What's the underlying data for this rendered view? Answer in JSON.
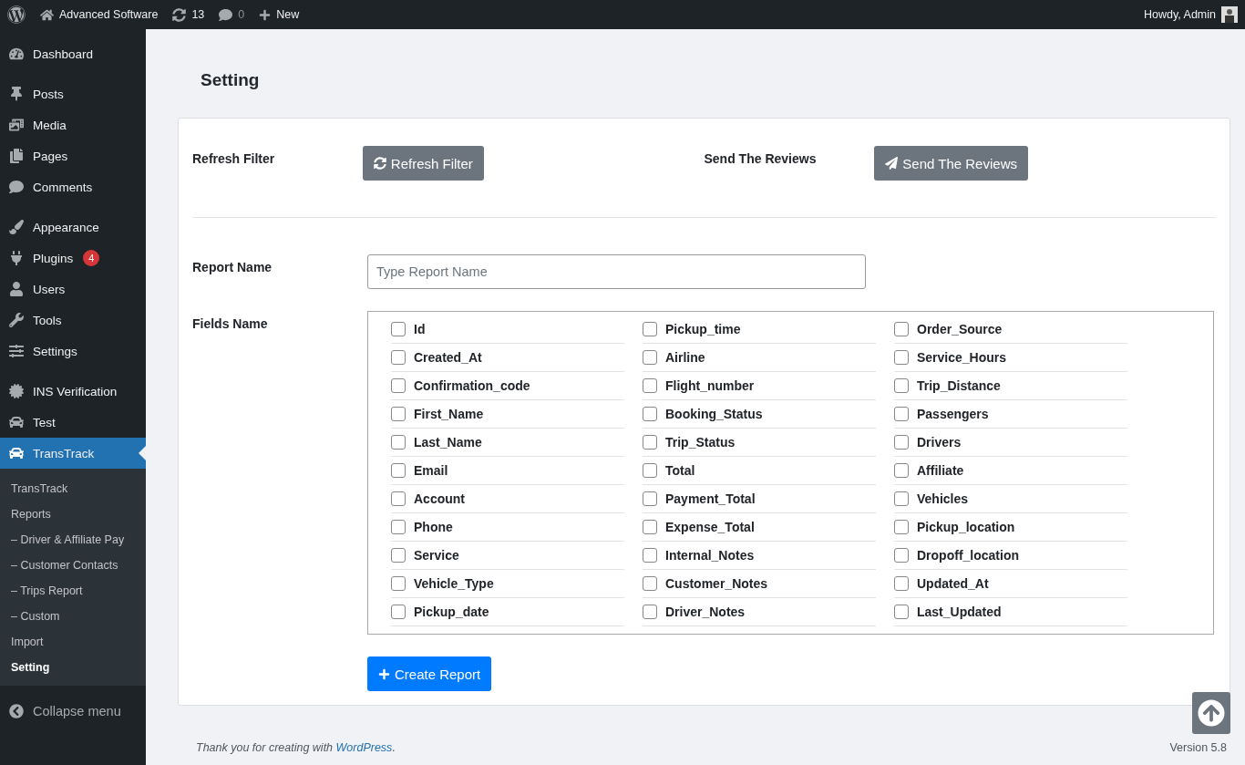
{
  "admin_bar": {
    "site_name": "Advanced Software",
    "updates": "13",
    "comments": "0",
    "new_label": "New",
    "greeting": "Howdy, Admin"
  },
  "sidebar": {
    "groups": [
      [
        {
          "label": "Dashboard",
          "selected": false
        }
      ],
      [
        {
          "label": "Posts",
          "selected": false
        },
        {
          "label": "Media",
          "selected": false
        },
        {
          "label": "Pages",
          "selected": false
        },
        {
          "label": "Comments",
          "selected": false
        }
      ],
      [
        {
          "label": "Appearance",
          "selected": false
        },
        {
          "label": "Plugins",
          "selected": false,
          "badge": "4"
        },
        {
          "label": "Users",
          "selected": false
        },
        {
          "label": "Tools",
          "selected": false
        },
        {
          "label": "Settings",
          "selected": false
        }
      ],
      [
        {
          "label": "INS Verification",
          "selected": false
        },
        {
          "label": "Test",
          "selected": false
        },
        {
          "label": "TransTrack",
          "selected": true,
          "children": [
            {
              "label": "TransTrack",
              "selected": false
            },
            {
              "label": "Reports",
              "selected": false
            },
            {
              "label": "– Driver & Affiliate Pay",
              "selected": false
            },
            {
              "label": "– Customer Contacts",
              "selected": false
            },
            {
              "label": "– Trips Report",
              "selected": false
            },
            {
              "label": "– Custom",
              "selected": false
            },
            {
              "label": "Import",
              "selected": false
            },
            {
              "label": "Setting",
              "selected": true
            }
          ]
        }
      ]
    ],
    "collapse_label": "Collapse menu"
  },
  "page_title": "Setting",
  "actions": [
    {
      "label": "Refresh Filter",
      "button": "Refresh Filter",
      "kind": "refresh"
    },
    {
      "label": "Send The Reviews",
      "button": "Send The Reviews",
      "kind": "send"
    }
  ],
  "report_name": {
    "label": "Report Name",
    "placeholder": "Type Report Name"
  },
  "fields_label": "Fields Name",
  "fields": [
    {
      "label": "Id",
      "checked": false
    },
    {
      "label": "Created_At",
      "checked": false
    },
    {
      "label": "Confirmation_code",
      "checked": false
    },
    {
      "label": "First_Name",
      "checked": false
    },
    {
      "label": "Last_Name",
      "checked": false
    },
    {
      "label": "Email",
      "checked": false
    },
    {
      "label": "Account",
      "checked": false
    },
    {
      "label": "Phone",
      "checked": false
    },
    {
      "label": "Service",
      "checked": false
    },
    {
      "label": "Vehicle_Type",
      "checked": false
    },
    {
      "label": "Pickup_date",
      "checked": false
    },
    {
      "label": "Pickup_time",
      "checked": false
    },
    {
      "label": "Airline",
      "checked": false
    },
    {
      "label": "Flight_number",
      "checked": false
    },
    {
      "label": "Booking_Status",
      "checked": false
    },
    {
      "label": "Trip_Status",
      "checked": false
    },
    {
      "label": "Total",
      "checked": false
    },
    {
      "label": "Payment_Total",
      "checked": false
    },
    {
      "label": "Expense_Total",
      "checked": false
    },
    {
      "label": "Internal_Notes",
      "checked": false
    },
    {
      "label": "Customer_Notes",
      "checked": false
    },
    {
      "label": "Driver_Notes",
      "checked": false
    },
    {
      "label": "Order_Source",
      "checked": false
    },
    {
      "label": "Service_Hours",
      "checked": false
    },
    {
      "label": "Trip_Distance",
      "checked": false
    },
    {
      "label": "Passengers",
      "checked": false
    },
    {
      "label": "Drivers",
      "checked": false
    },
    {
      "label": "Affiliate",
      "checked": false
    },
    {
      "label": "Vehicles",
      "checked": false
    },
    {
      "label": "Pickup_location",
      "checked": false
    },
    {
      "label": "Dropoff_location",
      "checked": false
    },
    {
      "label": "Updated_At",
      "checked": false
    },
    {
      "label": "Last_Updated",
      "checked": false
    }
  ],
  "create_button": "Create Report",
  "footer": {
    "text": "Thank you for creating with ",
    "link": "WordPress",
    "end": ".",
    "version": "Version 5.8"
  }
}
